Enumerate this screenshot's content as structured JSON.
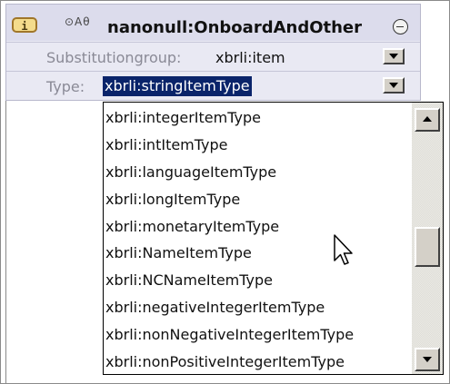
{
  "element_box": {
    "info_icon_label": "i",
    "mini_icons": "⊙Aθ",
    "title": "nanonull:OnboardAndOther",
    "substitution_row": {
      "label": "Substitutiongroup:",
      "value": "xbrli:item"
    },
    "type_row": {
      "label": "Type:",
      "value": "xbrli:stringItemType"
    }
  },
  "dropdown": {
    "items": [
      "xbrli:integerItemType",
      "xbrli:intItemType",
      "xbrli:languageItemType",
      "xbrli:longItemType",
      "xbrli:monetaryItemType",
      "xbrli:NameItemType",
      "xbrli:NCNameItemType",
      "xbrli:negativeIntegerItemType",
      "xbrli:nonNegativeIntegerItemType",
      "xbrli:nonPositiveIntegerItemType"
    ]
  },
  "colors": {
    "selection": "#0a246a",
    "header_bg": "#dcdcec",
    "info_icon": "#f4dc8c"
  }
}
